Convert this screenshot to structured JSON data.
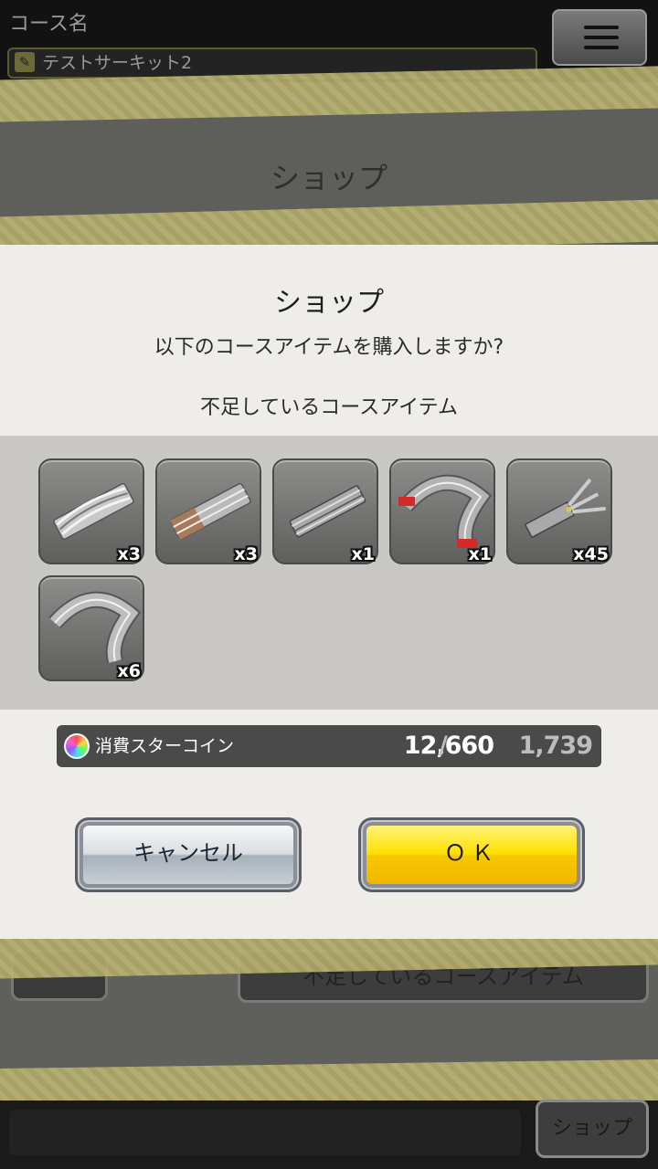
{
  "background": {
    "course_label": "コース名",
    "course_name": "テストサーキット2",
    "title": "ショップ",
    "missing_button": "不足しているコースアイテム",
    "shop_button": "ショップ"
  },
  "dialog": {
    "title": "ショップ",
    "question": "以下のコースアイテムを購入しますか?",
    "missing_label": "不足しているコースアイテム",
    "items": [
      {
        "icon": "straight-ramp-track-icon",
        "qty": "x3"
      },
      {
        "icon": "straight-slope-track-icon",
        "qty": "x3"
      },
      {
        "icon": "straight-track-icon",
        "qty": "x1"
      },
      {
        "icon": "curve-track-red-icon",
        "qty": "x1"
      },
      {
        "icon": "lane-change-track-icon",
        "qty": "x45"
      },
      {
        "icon": "curve-track-icon",
        "qty": "x6"
      }
    ],
    "coin_label": "消費スターコイン",
    "coin_cost": "12,660",
    "coin_slash": "/",
    "coin_have": "1,739",
    "cancel_label": "キャンセル",
    "ok_label": "ＯＫ"
  },
  "colors": {
    "ok_button": "#ffd800",
    "tape": "#b5ae6a",
    "modal_bg": "#eeedea"
  }
}
